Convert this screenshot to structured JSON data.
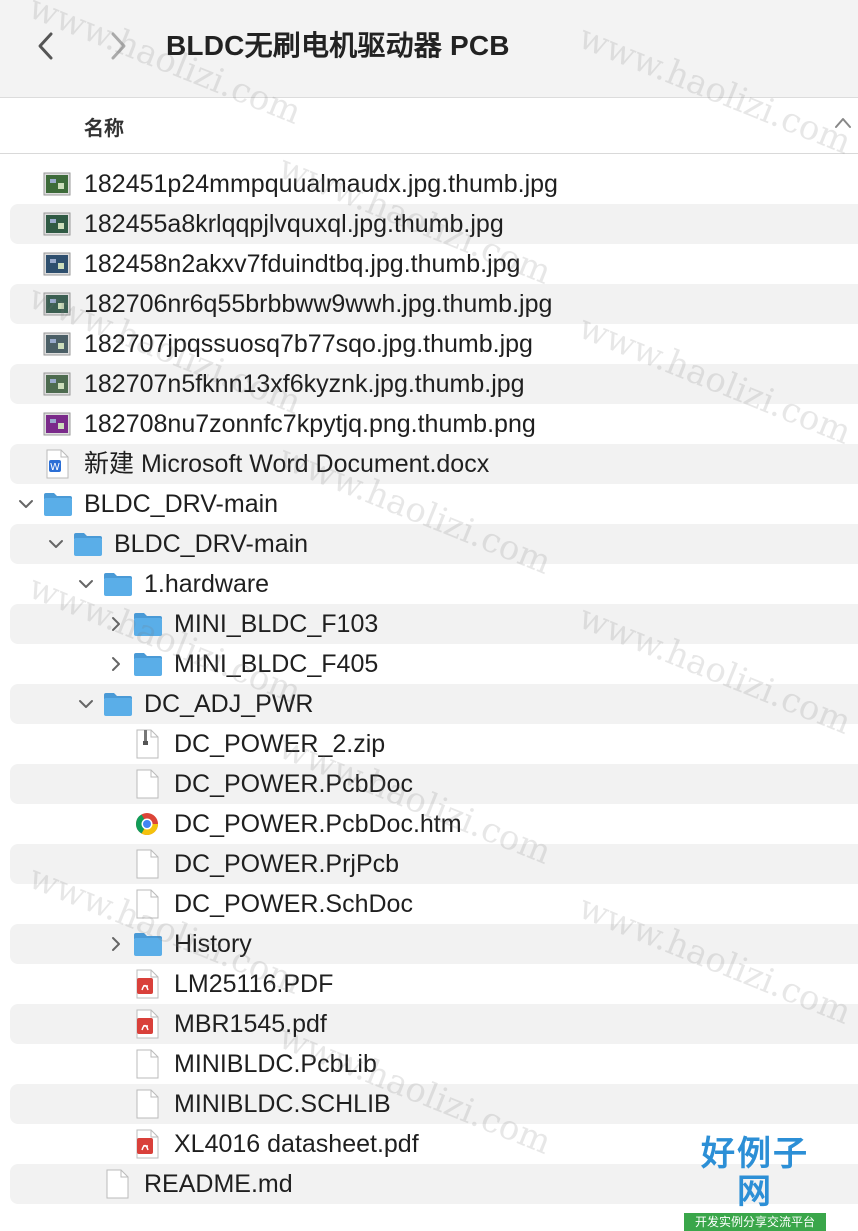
{
  "window": {
    "title": "BLDC无刷电机驱动器 PCB",
    "back_icon": "chevron-left-icon",
    "forward_icon": "chevron-right-icon"
  },
  "columns": {
    "name": "名称",
    "sort_icon": "chevron-up-icon"
  },
  "files": [
    {
      "name": "182451p24mmpquualmaudx.jpg.thumb.jpg",
      "icon": "image-thumbnail-icon",
      "thumb_color": "#3d6b3a",
      "level": 0
    },
    {
      "name": "182455a8krlqqpjlvquxql.jpg.thumb.jpg",
      "icon": "image-thumbnail-icon",
      "thumb_color": "#2f5a44",
      "level": 0
    },
    {
      "name": "182458n2akxv7fduindtbq.jpg.thumb.jpg",
      "icon": "image-thumbnail-icon",
      "thumb_color": "#2e4f6e",
      "level": 0
    },
    {
      "name": "182706nr6q55brbbww9wwh.jpg.thumb.jpg",
      "icon": "image-thumbnail-icon",
      "thumb_color": "#3b5f52",
      "level": 0
    },
    {
      "name": "182707jpqssuosq7b77sqo.jpg.thumb.jpg",
      "icon": "image-thumbnail-icon",
      "thumb_color": "#4b5f66",
      "level": 0
    },
    {
      "name": "182707n5fknn13xf6kyznk.jpg.thumb.jpg",
      "icon": "image-thumbnail-icon",
      "thumb_color": "#4d6b4f",
      "level": 0
    },
    {
      "name": "182708nu7zonnfc7kpytjq.png.thumb.png",
      "icon": "image-thumbnail-icon",
      "thumb_color": "#7a2a8a",
      "level": 0
    },
    {
      "name": "新建 Microsoft Word Document.docx",
      "icon": "word-document-icon",
      "level": 0
    },
    {
      "name": "BLDC_DRV-main",
      "icon": "folder-icon",
      "expanded": true,
      "level": 0
    },
    {
      "name": "BLDC_DRV-main",
      "icon": "folder-icon",
      "expanded": true,
      "level": 1
    },
    {
      "name": "1.hardware",
      "icon": "folder-icon",
      "expanded": true,
      "level": 2
    },
    {
      "name": "MINI_BLDC_F103",
      "icon": "folder-icon",
      "expanded": false,
      "level": 3
    },
    {
      "name": "MINI_BLDC_F405",
      "icon": "folder-icon",
      "expanded": false,
      "level": 3
    },
    {
      "name": "DC_ADJ_PWR",
      "icon": "folder-icon",
      "expanded": true,
      "level": 2
    },
    {
      "name": "DC_POWER_2.zip",
      "icon": "zip-archive-icon",
      "level": 3
    },
    {
      "name": "DC_POWER.PcbDoc",
      "icon": "blank-document-icon",
      "level": 3
    },
    {
      "name": "DC_POWER.PcbDoc.htm",
      "icon": "chrome-html-icon",
      "level": 3
    },
    {
      "name": "DC_POWER.PrjPcb",
      "icon": "blank-document-icon",
      "level": 3
    },
    {
      "name": "DC_POWER.SchDoc",
      "icon": "blank-document-icon",
      "level": 3
    },
    {
      "name": "History",
      "icon": "folder-icon",
      "expanded": false,
      "level": 3
    },
    {
      "name": "LM25116.PDF",
      "icon": "pdf-document-icon",
      "level": 3
    },
    {
      "name": "MBR1545.pdf",
      "icon": "pdf-document-icon",
      "level": 3
    },
    {
      "name": "MINIBLDC.PcbLib",
      "icon": "blank-document-icon",
      "level": 3
    },
    {
      "name": "MINIBLDC.SCHLIB",
      "icon": "blank-document-icon",
      "level": 3
    },
    {
      "name": "XL4016 datasheet.pdf",
      "icon": "pdf-document-icon",
      "level": 3
    },
    {
      "name": "README.md",
      "icon": "blank-document-icon",
      "level": 2
    }
  ],
  "watermark": {
    "text": "www.haolizi.com"
  },
  "logo": {
    "main": "好例子网",
    "sub": "开发实例分享交流平台"
  },
  "colors": {
    "folder": "#5aaee8",
    "folder_tab": "#4a9ad6",
    "stripe": "#f2f2f2",
    "pdf": "#d9403a",
    "word": "#2b6fd6"
  }
}
